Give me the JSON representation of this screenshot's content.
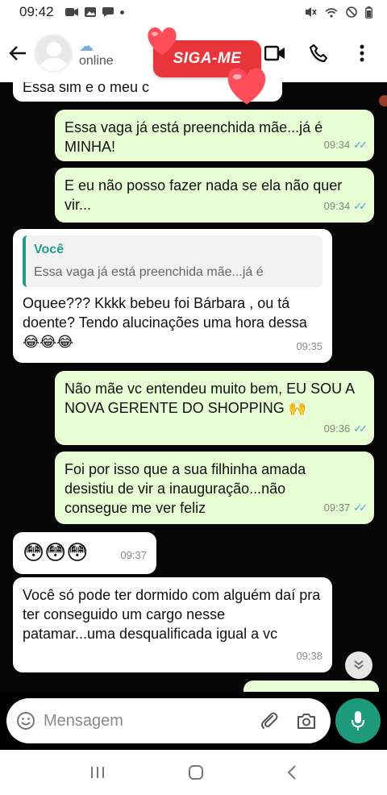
{
  "status_bar": {
    "time": "09:42"
  },
  "header": {
    "back_icon": "arrow-left-icon",
    "contact_emoji": "☁",
    "presence": "online",
    "actions": [
      "video-call-icon",
      "voice-call-icon",
      "more-options-icon"
    ]
  },
  "sticker": {
    "label": "SIGA-ME"
  },
  "messages": [
    {
      "type": "incoming",
      "text": "Essa sim e o meu c",
      "time": ""
    },
    {
      "type": "outgoing",
      "text": "Essa vaga já está preenchida mãe...já é MINHA!",
      "time": "09:34"
    },
    {
      "type": "outgoing",
      "text": "E eu não posso fazer nada se ela não quer vir...",
      "time": "09:34"
    },
    {
      "type": "incoming",
      "quote_author": "Você",
      "quote_text": "Essa vaga já está preenchida mãe...já é",
      "text": "Oquee??? Kkkk bebeu foi Bárbara , ou tá doente? Tendo alucinações uma hora dessa😂😂😂",
      "time": "09:35"
    },
    {
      "type": "outgoing",
      "text": "Não mãe vc entendeu muito bem,  EU SOU A NOVA GERENTE DO SHOPPING 🙌",
      "time": "09:36"
    },
    {
      "type": "outgoing",
      "text": "Foi por isso que a sua filhinha amada desistiu de vir a inauguração...não consegue me ver feliz",
      "time": "09:37"
    },
    {
      "type": "incoming",
      "text": "😳😳😳",
      "time": "09:37"
    },
    {
      "type": "incoming",
      "text": "Você só pode ter dormido com alguém daí pra ter conseguido um cargo nesse patamar...uma desqualificada igual a vc",
      "time": "09:38"
    }
  ],
  "input": {
    "placeholder": "Mensagem"
  },
  "colors": {
    "outgoing_bubble": "#e7fed4",
    "incoming_bubble": "#ffffff",
    "accent": "#1d9a7c",
    "read_ticks": "#4aa0e6",
    "sticker": "#e8353a"
  }
}
